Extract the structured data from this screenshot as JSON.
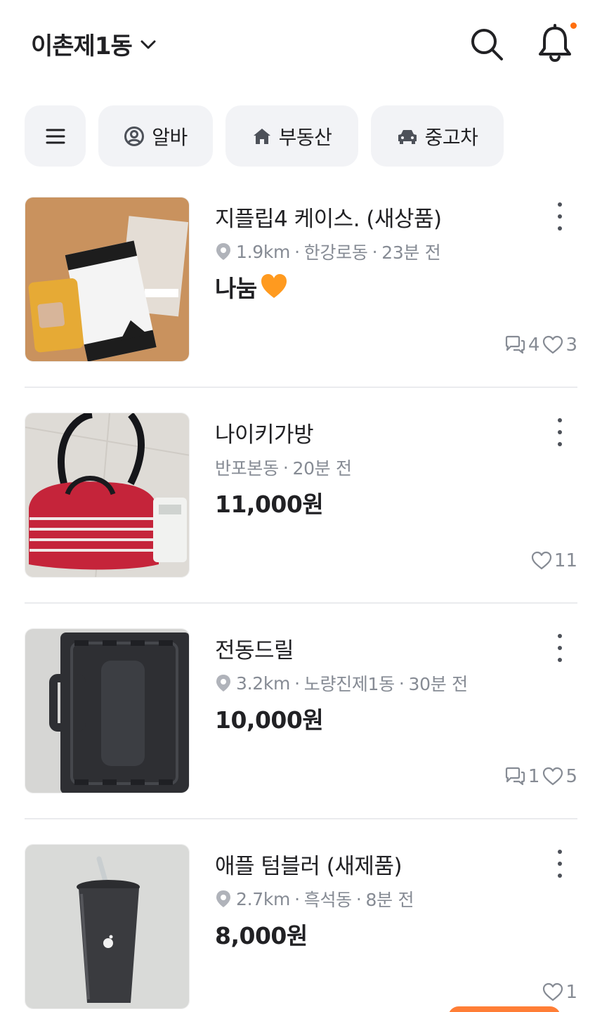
{
  "header": {
    "location": "이촌제1동",
    "search_icon": "search-icon",
    "bell_icon": "bell-icon",
    "notification_dot_color": "#ff6f0f"
  },
  "chips": [
    {
      "icon": "menu-icon",
      "label": ""
    },
    {
      "icon": "user-circle-icon",
      "label": "알바"
    },
    {
      "icon": "house-icon",
      "label": "부동산"
    },
    {
      "icon": "car-icon",
      "label": "중고차"
    }
  ],
  "items": [
    {
      "title": "지플립4 케이스. (새상품)",
      "distance": "1.9km",
      "area": "한강로동",
      "time": "23분 전",
      "price": "나눔",
      "price_emoji": "orange-heart-icon",
      "chats": "4",
      "likes": "3"
    },
    {
      "title": "나이키가방",
      "distance": "",
      "area": "반포본동",
      "time": "20분 전",
      "price": "11,000원",
      "chats": "",
      "likes": "11"
    },
    {
      "title": "전동드릴",
      "distance": "3.2km",
      "area": "노량진제1동",
      "time": "30분 전",
      "price": "10,000원",
      "chats": "1",
      "likes": "5"
    },
    {
      "title": "애플 텀블러 (새제품)",
      "distance": "2.7km",
      "area": "흑석동",
      "time": "8분 전",
      "price": "8,000원",
      "chats": "",
      "likes": "1"
    }
  ],
  "separator": "·",
  "accent_color": "#ff6f0f"
}
